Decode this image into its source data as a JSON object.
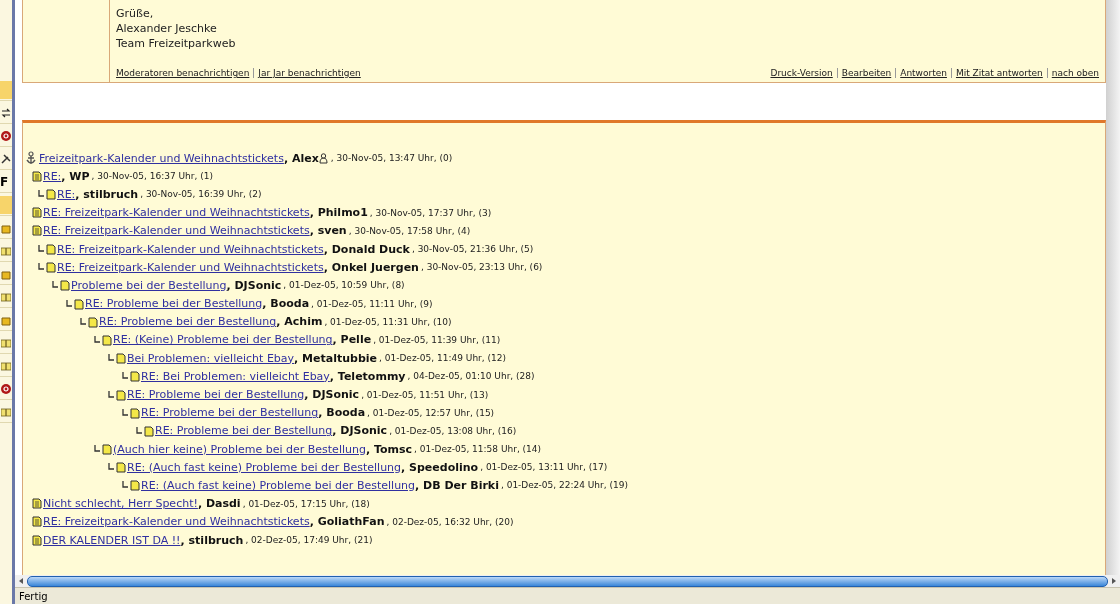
{
  "background_window": {
    "label": "F"
  },
  "post": {
    "signature": [
      "Grüße,",
      "Alexander Jeschke",
      "Team Freizeitparkweb"
    ],
    "left_links": [
      "Moderatoren benachrichtigen",
      "Jar Jar benachrichtigen"
    ],
    "right_links": [
      "Druck-Version",
      "Bearbeiten",
      "Antworten",
      "Mit Zitat antworten",
      "nach oben"
    ]
  },
  "thread": {
    "root": {
      "title": "Freizeitpark-Kalender und Weihnachtstickets",
      "author": ", Alex",
      "user_icon": true,
      "meta": " , 30-Nov-05, 13:47 Uhr, (0)",
      "children": [
        {
          "title": "RE:",
          "author": ", WP",
          "meta": ", 30-Nov-05, 16:37 Uhr, (1)",
          "children": [
            {
              "title": "RE:",
              "author": ", stilbruch",
              "meta": ", 30-Nov-05, 16:39 Uhr, (2)"
            }
          ]
        },
        {
          "title": "RE: Freizeitpark-Kalender und Weihnachtstickets",
          "author": ", Philmo1",
          "meta": ", 30-Nov-05, 17:37 Uhr, (3)"
        },
        {
          "title": "RE: Freizeitpark-Kalender und Weihnachtstickets",
          "author": ", sven",
          "meta": ", 30-Nov-05, 17:58 Uhr, (4)",
          "children": [
            {
              "title": "RE: Freizeitpark-Kalender und Weihnachtstickets",
              "author": ", Donald Duck",
              "meta": ", 30-Nov-05, 21:36 Uhr, (5)"
            },
            {
              "title": "RE: Freizeitpark-Kalender und Weihnachtstickets",
              "author": ", Onkel Juergen",
              "meta": ", 30-Nov-05, 23:13 Uhr, (6)",
              "children": [
                {
                  "title": "Probleme bei der Bestellung",
                  "author": ", DJSonic",
                  "meta": ", 01-Dez-05, 10:59 Uhr, (8)",
                  "children": [
                    {
                      "title": "RE: Probleme bei der Bestellung",
                      "author": ", Booda",
                      "meta": ", 01-Dez-05, 11:11 Uhr, (9)",
                      "children": [
                        {
                          "title": "RE: Probleme bei der Bestellung",
                          "author": ", Achim",
                          "meta": ", 01-Dez-05, 11:31 Uhr, (10)",
                          "children": [
                            {
                              "title": "RE: (Keine) Probleme bei der Bestellung",
                              "author": ", Pelle",
                              "meta": ", 01-Dez-05, 11:39 Uhr, (11)",
                              "children": [
                                {
                                  "title": "Bei Problemen: vielleicht Ebay",
                                  "author": ", Metaltubbie",
                                  "meta": ", 01-Dez-05, 11:49 Uhr, (12)",
                                  "children": [
                                    {
                                      "title": "RE: Bei Problemen: vielleicht Ebay",
                                      "author": ", Teletommy",
                                      "meta": ", 04-Dez-05, 01:10 Uhr, (28)"
                                    }
                                  ]
                                },
                                {
                                  "title": "RE: Probleme bei der Bestellung",
                                  "author": ", DJSonic",
                                  "meta": ", 01-Dez-05, 11:51 Uhr, (13)",
                                  "children": [
                                    {
                                      "title": "RE: Probleme bei der Bestellung",
                                      "author": ", Booda",
                                      "meta": ", 01-Dez-05, 12:57 Uhr, (15)",
                                      "children": [
                                        {
                                          "title": "RE: Probleme bei der Bestellung",
                                          "author": ", DJSonic",
                                          "meta": ", 01-Dez-05, 13:08 Uhr, (16)"
                                        }
                                      ]
                                    }
                                  ]
                                }
                              ]
                            },
                            {
                              "title": "(Auch hier keine) Probleme bei der Bestellung",
                              "author": ", Tomsc",
                              "meta": ", 01-Dez-05, 11:58 Uhr, (14)",
                              "children": [
                                {
                                  "title": "RE: (Auch fast keine) Probleme bei der Bestellung",
                                  "author": ", Speedolino",
                                  "meta": ", 01-Dez-05, 13:11 Uhr, (17)",
                                  "children": [
                                    {
                                      "title": "RE: (Auch fast keine) Probleme bei der Bestellung",
                                      "author": ", DB Der Birki",
                                      "meta": ", 01-Dez-05, 22:24 Uhr, (19)"
                                    }
                                  ]
                                }
                              ]
                            }
                          ]
                        }
                      ]
                    }
                  ]
                }
              ]
            }
          ]
        },
        {
          "title": "Nicht schlecht, Herr Specht!",
          "author": ", Dasdi",
          "meta": ", 01-Dez-05, 17:15 Uhr, (18)"
        },
        {
          "title": "RE: Freizeitpark-Kalender und Weihnachtstickets",
          "author": ", GoliathFan",
          "meta": ", 02-Dez-05, 16:32 Uhr, (20)"
        },
        {
          "title": "DER KALENDER IST DA !!",
          "author": ", stilbruch",
          "meta": ", 02-Dez-05, 17:49 Uhr, (21)"
        }
      ]
    }
  },
  "status_bar": {
    "text": "Fertig"
  }
}
